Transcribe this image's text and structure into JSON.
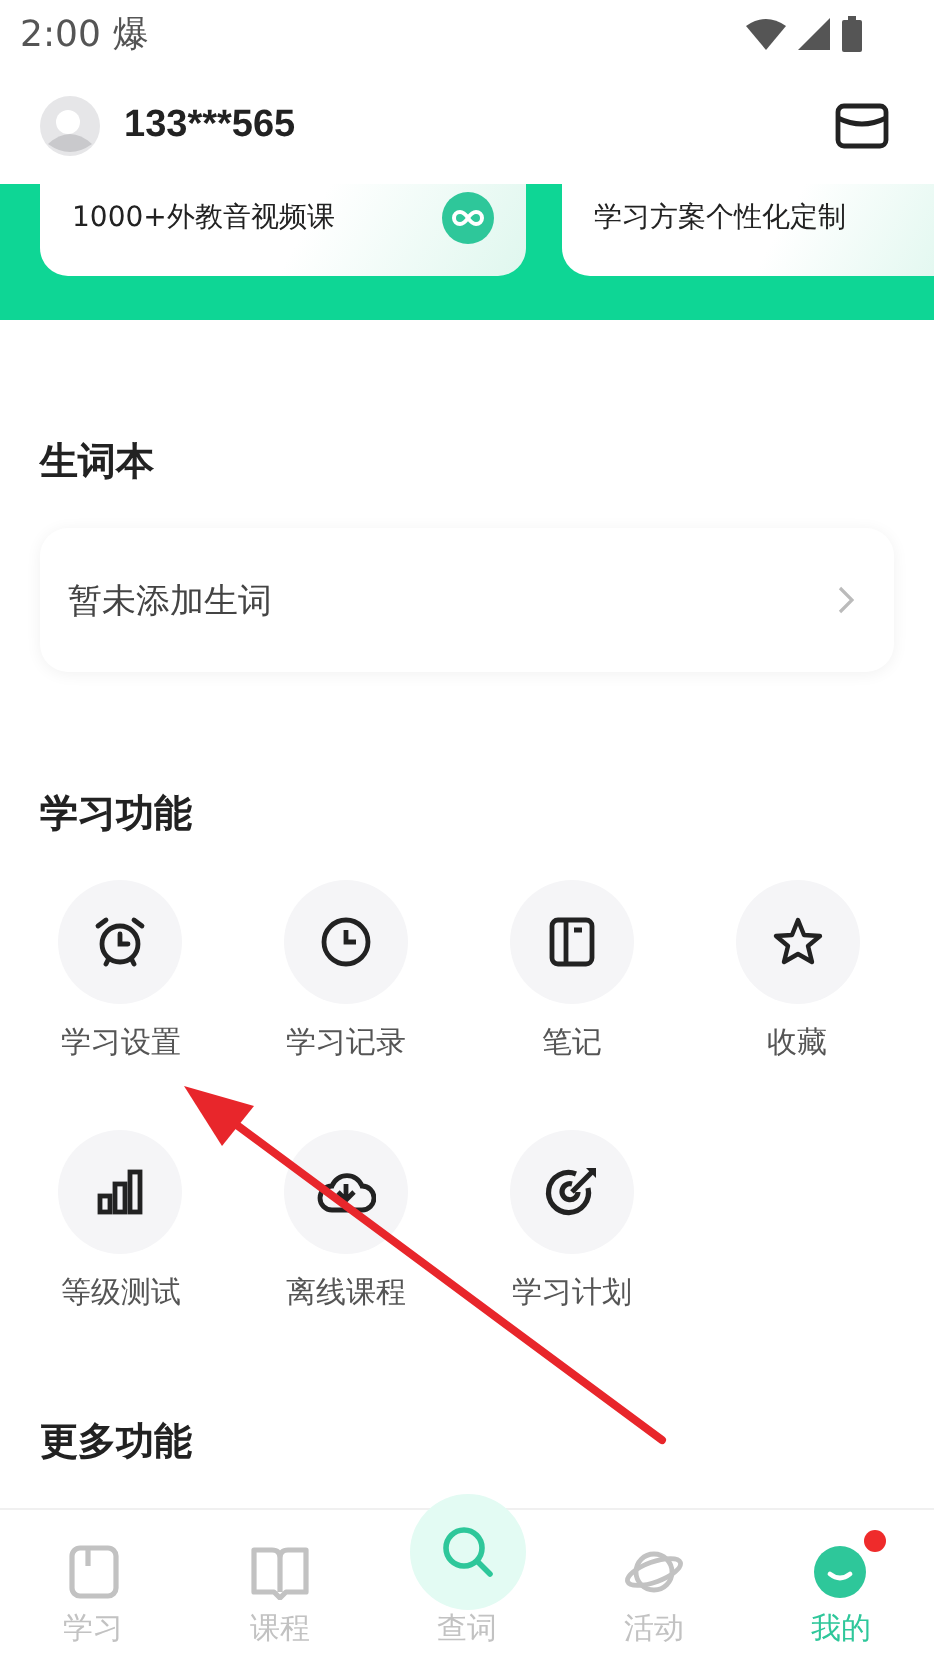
{
  "status_bar": {
    "time": "2:00",
    "app_glyph": "爆"
  },
  "header": {
    "username": "133***565"
  },
  "banner_cards": [
    {
      "text": "1000+外教音视频课",
      "kind": "loop"
    },
    {
      "text": "学习方案个性化定制",
      "kind": "plain"
    }
  ],
  "vocabulary": {
    "title": "生词本",
    "empty_text": "暂未添加生词"
  },
  "study_features": {
    "title": "学习功能",
    "items": [
      {
        "label": "学习设置",
        "kind": "alarm"
      },
      {
        "label": "学习记录",
        "kind": "clock"
      },
      {
        "label": "笔记",
        "kind": "notebook"
      },
      {
        "label": "收藏",
        "kind": "star"
      },
      {
        "label": "等级测试",
        "kind": "bars"
      },
      {
        "label": "离线课程",
        "kind": "cloud"
      },
      {
        "label": "学习计划",
        "kind": "target"
      }
    ]
  },
  "more_features": {
    "title": "更多功能"
  },
  "bottom_nav": [
    {
      "label": "学习",
      "kind": "study",
      "selected": false,
      "badge": false
    },
    {
      "label": "课程",
      "kind": "book",
      "selected": false,
      "badge": false
    },
    {
      "label": "查词",
      "kind": "search",
      "selected": false,
      "badge": false
    },
    {
      "label": "活动",
      "kind": "planet",
      "selected": false,
      "badge": false
    },
    {
      "label": "我的",
      "kind": "me",
      "selected": true,
      "badge": true
    }
  ]
}
